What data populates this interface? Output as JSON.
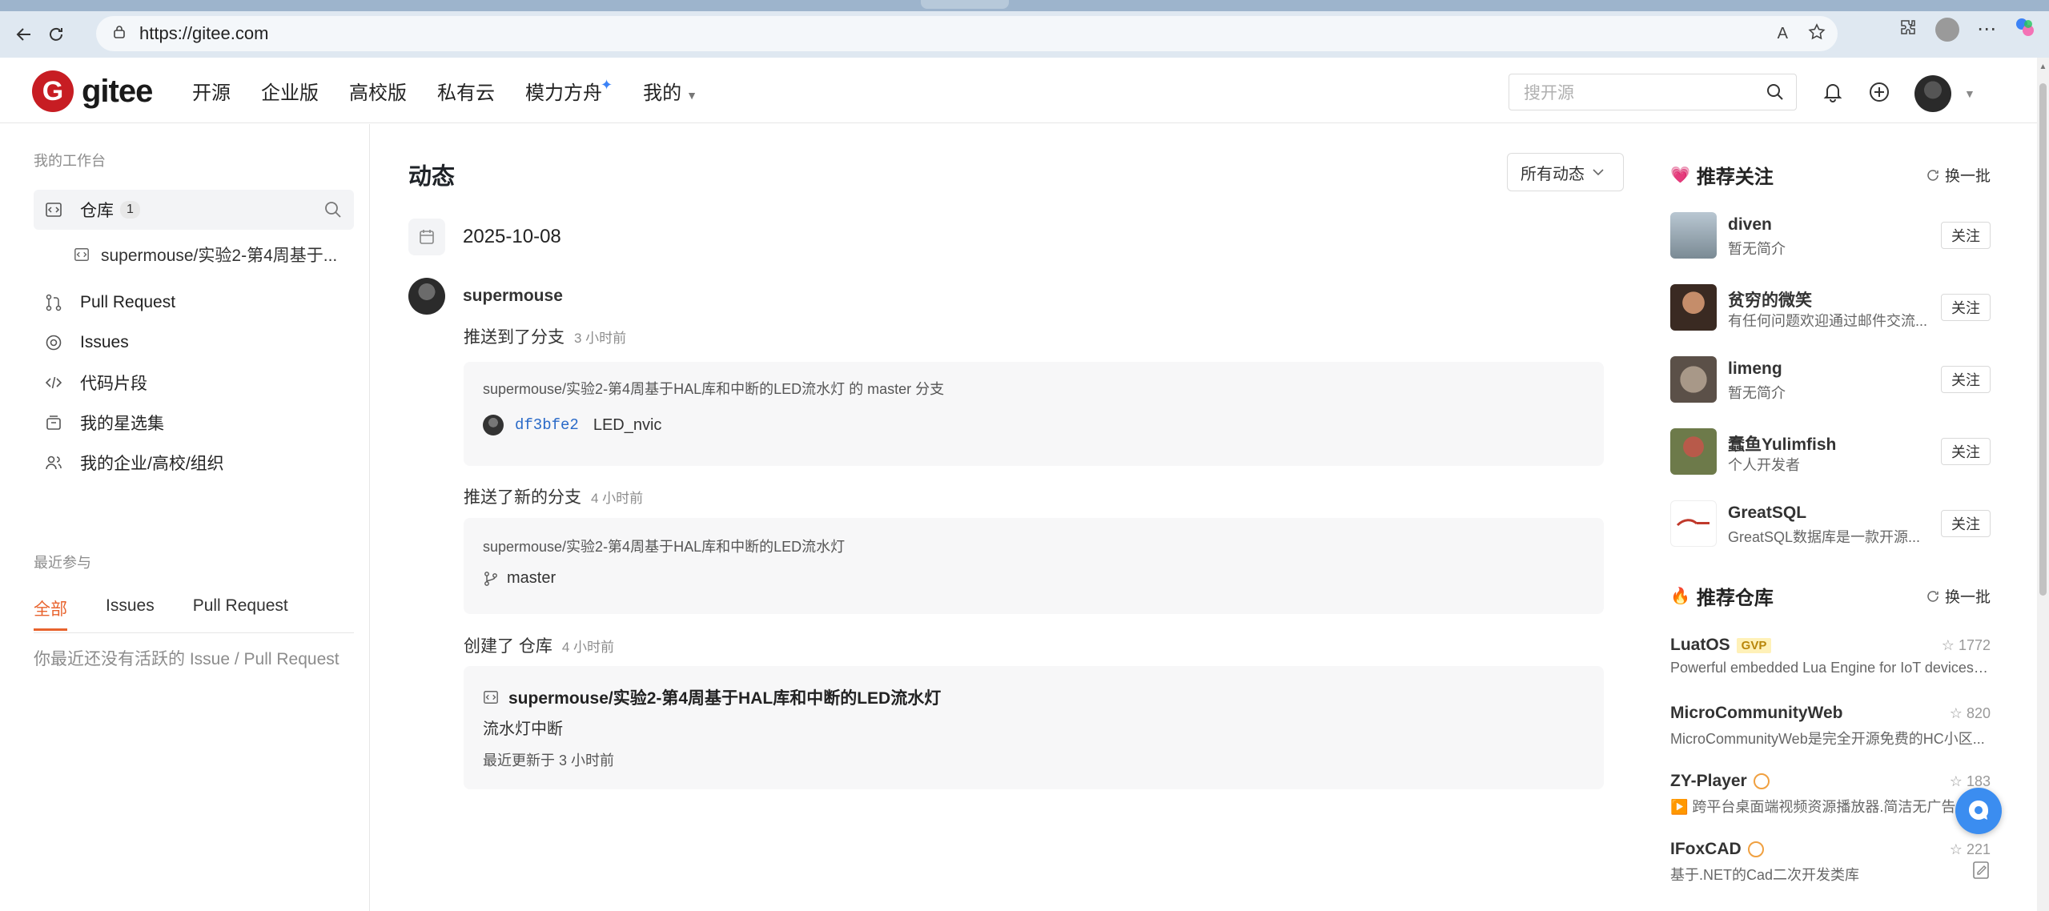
{
  "browser": {
    "url": "https://gitee.com"
  },
  "header": {
    "logo_text": "gitee",
    "nav": [
      "开源",
      "企业版",
      "高校版",
      "私有云",
      "模力方舟",
      "我的"
    ],
    "search_placeholder": "搜开源"
  },
  "sidebar": {
    "workspace_label": "我的工作台",
    "repo_label": "仓库",
    "repo_count": "1",
    "repo_sub": "supermouse/实验2-第4周基于...",
    "items": [
      "Pull Request",
      "Issues",
      "代码片段",
      "我的星选集",
      "我的企业/高校/组织"
    ],
    "recent_label": "最近参与",
    "filter_tabs": [
      "全部",
      "Issues",
      "Pull Request"
    ],
    "empty_message": "你最近还没有活跃的 Issue / Pull Request"
  },
  "feed": {
    "title": "动态",
    "filter": "所有动态",
    "date": "2025-10-08",
    "user": "supermouse",
    "events": [
      {
        "action": "推送到了分支",
        "time": "3 小时前",
        "path": "supermouse/实验2-第4周基于HAL库和中断的LED流水灯 的 master 分支",
        "sha": "df3bfe2",
        "message": "LED_nvic"
      },
      {
        "action": "推送了新的分支",
        "time": "4 小时前",
        "path": "supermouse/实验2-第4周基于HAL库和中断的LED流水灯",
        "branch": "master"
      },
      {
        "action": "创建了 仓库",
        "time": "4 小时前",
        "repo": "supermouse/实验2-第4周基于HAL库和中断的LED流水灯",
        "description": "流水灯中断",
        "updated": "最近更新于 3 小时前"
      }
    ]
  },
  "recommend_users": {
    "title": "推荐关注",
    "refresh": "换一批",
    "follow_label": "关注",
    "users": [
      {
        "name": "diven",
        "desc": "暂无简介"
      },
      {
        "name": "贫穷的微笑",
        "desc": "有任何问题欢迎通过邮件交流..."
      },
      {
        "name": "limeng",
        "desc": "暂无简介"
      },
      {
        "name": "蠢鱼Yulimfish",
        "desc": "个人开发者"
      },
      {
        "name": "GreatSQL",
        "desc": "GreatSQL数据库是一款开源..."
      }
    ]
  },
  "recommend_repos": {
    "title": "推荐仓库",
    "refresh": "换一批",
    "repos": [
      {
        "name": "LuatOS",
        "badge": "GVP",
        "stars": "1772",
        "desc": "Powerful embedded Lua Engine for IoT devices, ..."
      },
      {
        "name": "MicroCommunityWeb",
        "stars": "820",
        "desc": "MicroCommunityWeb是完全开源免费的HC小区..."
      },
      {
        "name": "ZY-Player",
        "stars": "183",
        "desc": "▶️ 跨平台桌面端视频资源播放器.简洁无广告"
      },
      {
        "name": "IFoxCAD",
        "stars": "221",
        "desc": "基于.NET的Cad二次开发类库"
      }
    ]
  },
  "colors": {
    "accent": "#e8632d",
    "brand": "#c71d23",
    "link": "#2a6ac8"
  }
}
